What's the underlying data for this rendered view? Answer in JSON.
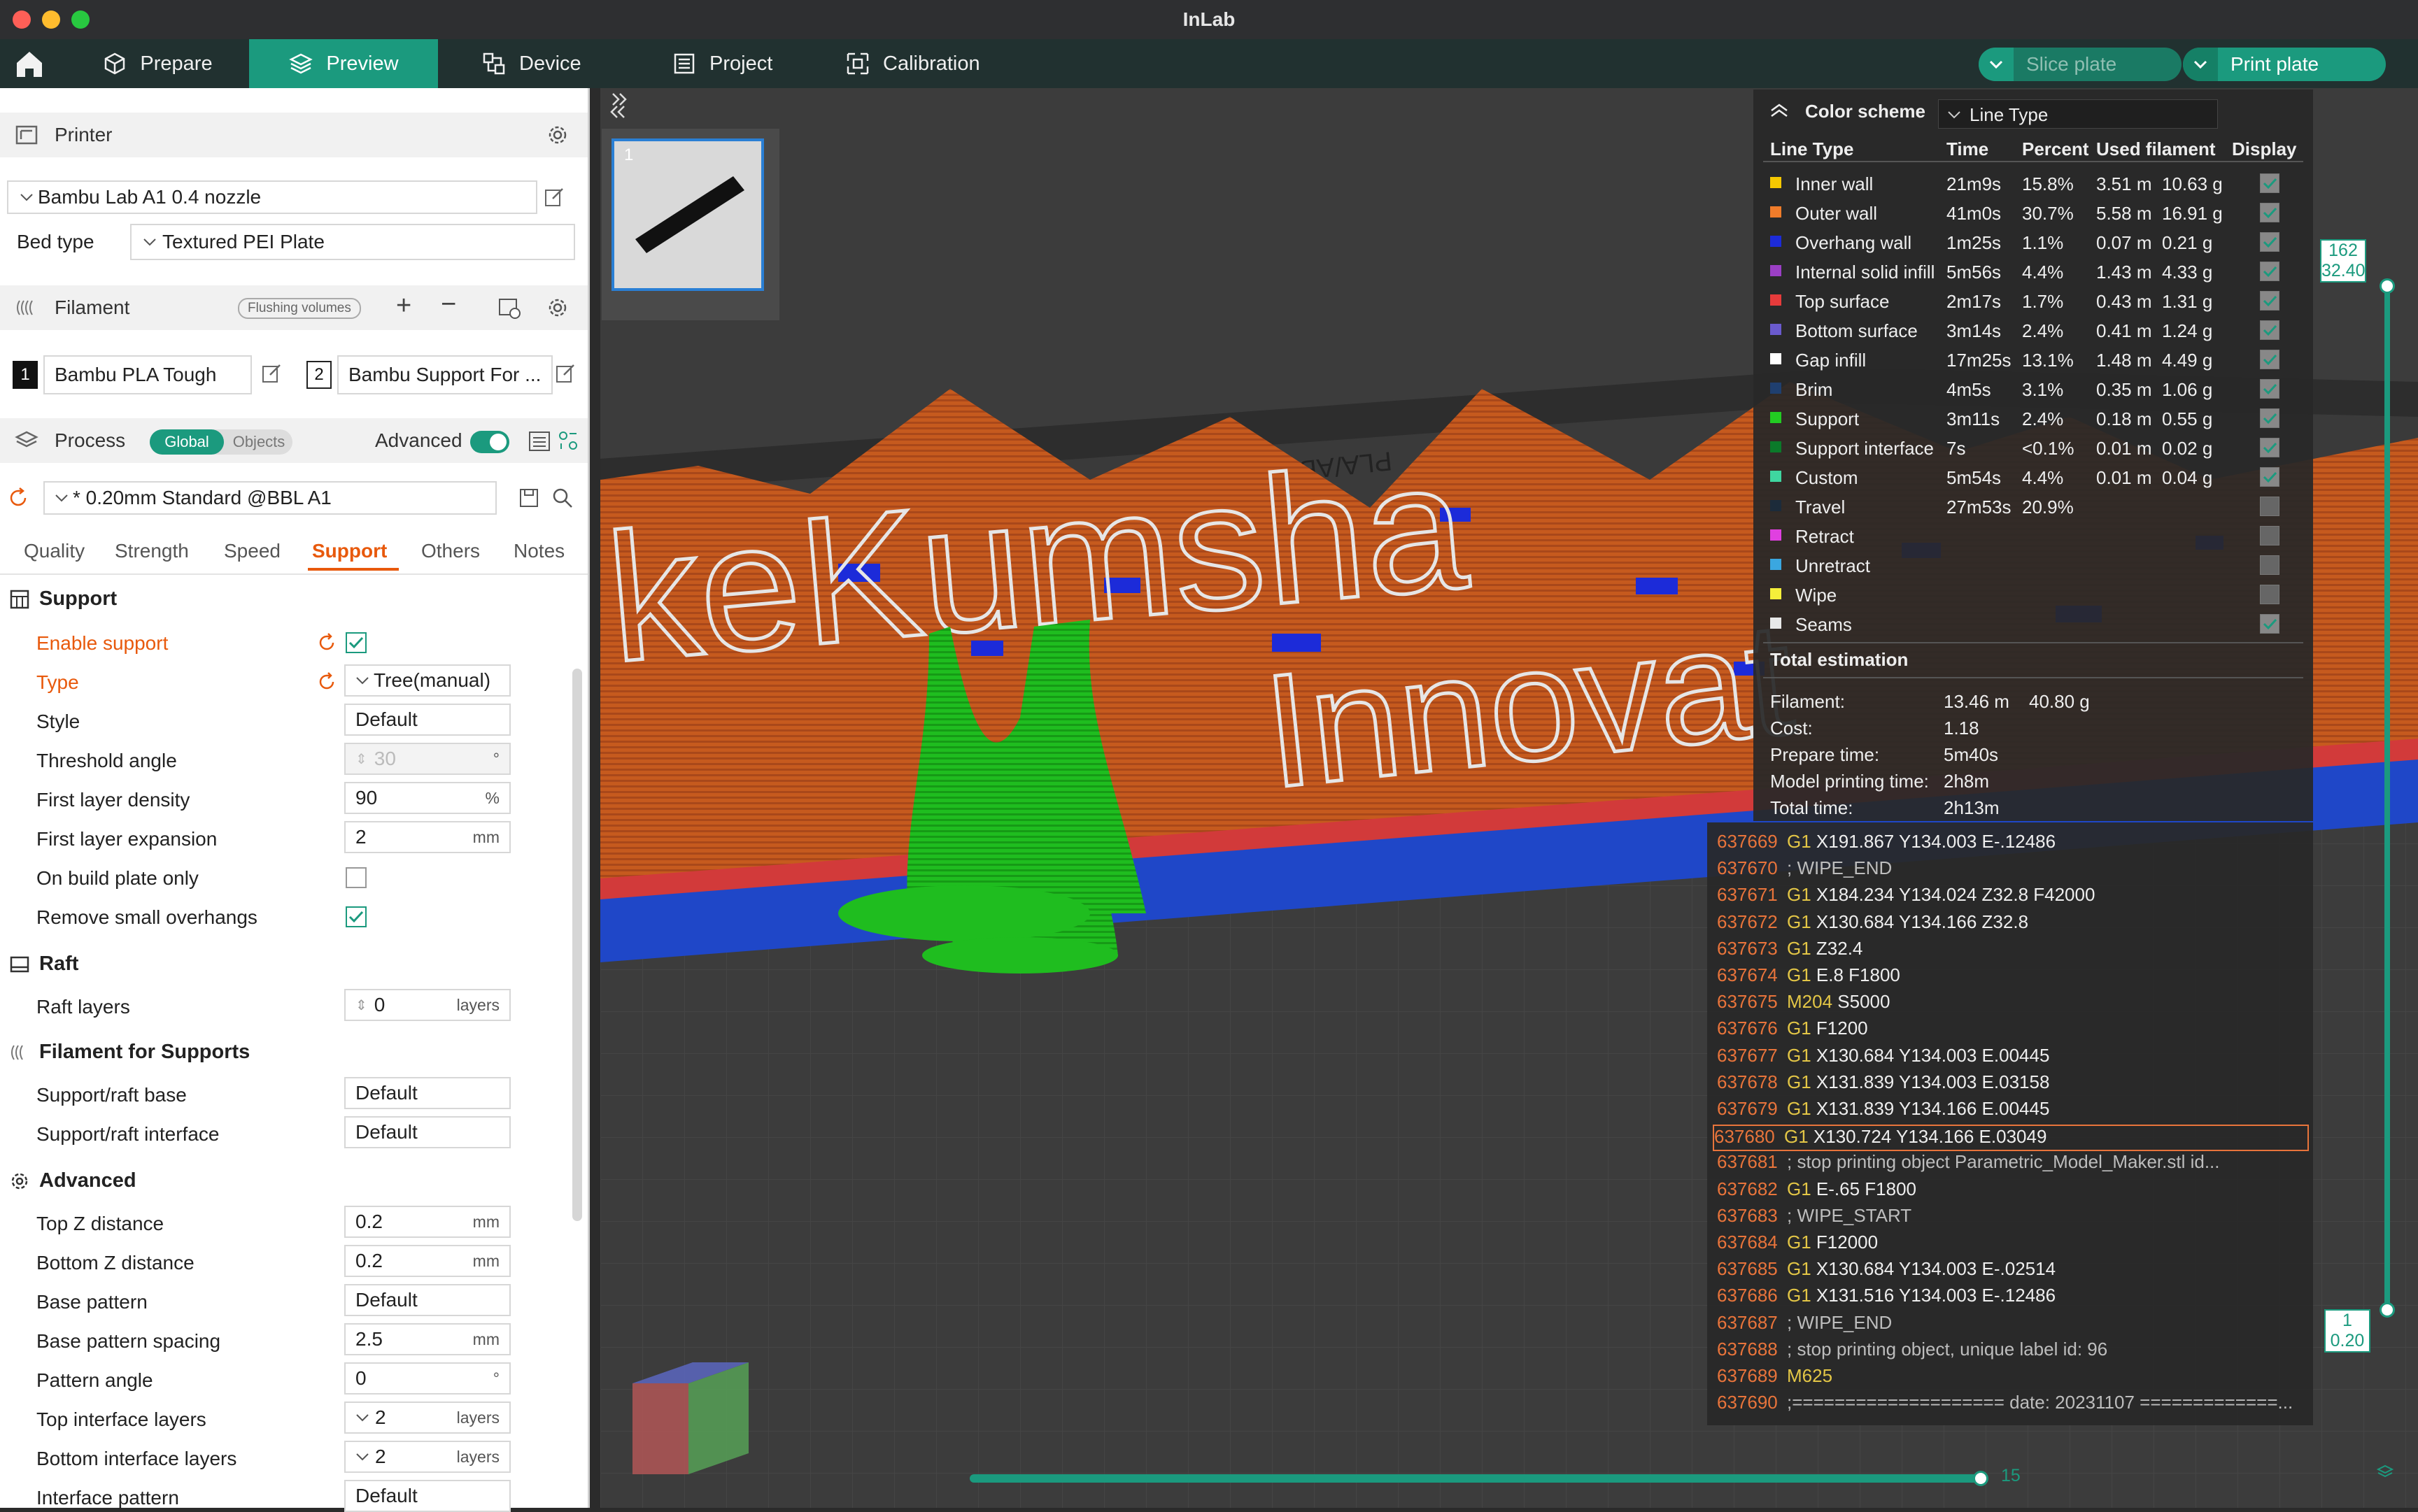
{
  "window": {
    "title": "InLab"
  },
  "nav": {
    "tabs": [
      {
        "label": "Prepare",
        "icon": "cube-icon"
      },
      {
        "label": "Preview",
        "icon": "layers-icon",
        "active": true
      },
      {
        "label": "Device",
        "icon": "device-icon"
      },
      {
        "label": "Project",
        "icon": "project-icon"
      },
      {
        "label": "Calibration",
        "icon": "calibration-icon"
      }
    ],
    "slice_label": "Slice plate",
    "print_label": "Print plate"
  },
  "printer": {
    "section_title": "Printer",
    "name": "Bambu Lab A1 0.4 nozzle",
    "bed_type_label": "Bed type",
    "bed_type": "Textured PEI Plate"
  },
  "filament": {
    "section_title": "Filament",
    "flushing_label": "Flushing volumes",
    "slots": [
      {
        "num": "1",
        "name": "Bambu PLA Tough"
      },
      {
        "num": "2",
        "name": "Bambu Support For ..."
      }
    ]
  },
  "process": {
    "section_title": "Process",
    "toggle_global": "Global",
    "toggle_objects": "Objects",
    "advanced_label": "Advanced",
    "preset": "* 0.20mm Standard @BBL A1",
    "tabs": [
      "Quality",
      "Strength",
      "Speed",
      "Support",
      "Others",
      "Notes"
    ],
    "active_tab": "Support"
  },
  "support": {
    "group_support": "Support",
    "enable_support": "Enable support",
    "type_label": "Type",
    "type_value": "Tree(manual)",
    "style_label": "Style",
    "style_value": "Default",
    "threshold_label": "Threshold angle",
    "threshold_value": "30",
    "threshold_unit": "°",
    "fld_label": "First layer density",
    "fld_value": "90",
    "fld_unit": "%",
    "fle_label": "First layer expansion",
    "fle_value": "2",
    "fle_unit": "mm",
    "obp_label": "On build plate only",
    "rso_label": "Remove small overhangs",
    "group_raft": "Raft",
    "raft_layers_label": "Raft layers",
    "raft_layers_value": "0",
    "raft_layers_unit": "layers",
    "group_filament": "Filament for Supports",
    "base_label": "Support/raft base",
    "base_value": "Default",
    "iface_label": "Support/raft interface",
    "iface_value": "Default",
    "group_advanced": "Advanced",
    "topz_label": "Top Z distance",
    "topz_value": "0.2",
    "botz_label": "Bottom Z distance",
    "botz_value": "0.2",
    "mm": "mm",
    "bp_label": "Base pattern",
    "bp_value": "Default",
    "bps_label": "Base pattern spacing",
    "bps_value": "2.5",
    "pa_label": "Pattern angle",
    "pa_value": "0",
    "deg": "°",
    "til_label": "Top interface layers",
    "til_value": "2",
    "bil_label": "Bottom interface layers",
    "bil_value": "2",
    "layers": "layers",
    "ip_label": "Interface pattern",
    "ip_value": "Default"
  },
  "legend": {
    "color_scheme_label": "Color scheme",
    "color_scheme_value": "Line Type",
    "headers": [
      "Line Type",
      "Time",
      "Percent",
      "Used filament",
      "Display"
    ],
    "rows": [
      {
        "name": "Inner wall",
        "color": "#f5c800",
        "time": "21m9s",
        "percent": "15.8%",
        "len": "3.51 m",
        "weight": "10.63 g",
        "display": true
      },
      {
        "name": "Outer wall",
        "color": "#f07c2a",
        "time": "41m0s",
        "percent": "30.7%",
        "len": "5.58 m",
        "weight": "16.91 g",
        "display": true
      },
      {
        "name": "Overhang wall",
        "color": "#1c2bd9",
        "time": "1m25s",
        "percent": "1.1%",
        "len": "0.07 m",
        "weight": "0.21 g",
        "display": true
      },
      {
        "name": "Internal solid infill",
        "color": "#9b3fc5",
        "time": "5m56s",
        "percent": "4.4%",
        "len": "1.43 m",
        "weight": "4.33 g",
        "display": true
      },
      {
        "name": "Top surface",
        "color": "#e63b3b",
        "time": "2m17s",
        "percent": "1.7%",
        "len": "0.43 m",
        "weight": "1.31 g",
        "display": true
      },
      {
        "name": "Bottom surface",
        "color": "#6a5acd",
        "time": "3m14s",
        "percent": "2.4%",
        "len": "0.41 m",
        "weight": "1.24 g",
        "display": true
      },
      {
        "name": "Gap infill",
        "color": "#ffffff",
        "time": "17m25s",
        "percent": "13.1%",
        "len": "1.48 m",
        "weight": "4.49 g",
        "display": true
      },
      {
        "name": "Brim",
        "color": "#1f3f6f",
        "time": "4m5s",
        "percent": "3.1%",
        "len": "0.35 m",
        "weight": "1.06 g",
        "display": true
      },
      {
        "name": "Support",
        "color": "#22cc22",
        "time": "3m11s",
        "percent": "2.4%",
        "len": "0.18 m",
        "weight": "0.55 g",
        "display": true
      },
      {
        "name": "Support interface",
        "color": "#0b7a2a",
        "time": "7s",
        "percent": "<0.1%",
        "len": "0.01 m",
        "weight": "0.02 g",
        "display": true
      },
      {
        "name": "Custom",
        "color": "#3fd6a0",
        "time": "5m54s",
        "percent": "4.4%",
        "len": "0.01 m",
        "weight": "0.04 g",
        "display": true
      },
      {
        "name": "Travel",
        "color": "#1c2b3a",
        "time": "27m53s",
        "percent": "20.9%",
        "len": "",
        "weight": "",
        "display": false
      },
      {
        "name": "Retract",
        "color": "#e040e0",
        "time": "",
        "percent": "",
        "len": "",
        "weight": "",
        "display": false
      },
      {
        "name": "Unretract",
        "color": "#3aa7e0",
        "time": "",
        "percent": "",
        "len": "",
        "weight": "",
        "display": false
      },
      {
        "name": "Wipe",
        "color": "#f5ef3a",
        "time": "",
        "percent": "",
        "len": "",
        "weight": "",
        "display": false
      },
      {
        "name": "Seams",
        "color": "#e8e8e8",
        "time": "",
        "percent": "",
        "len": "",
        "weight": "",
        "display": true
      }
    ],
    "total_title": "Total estimation",
    "totals": [
      {
        "label": "Filament:",
        "value": "13.46 m",
        "value2": "40.80 g"
      },
      {
        "label": "Cost:",
        "value": "1.18",
        "value2": ""
      },
      {
        "label": "Prepare time:",
        "value": "5m40s",
        "value2": ""
      },
      {
        "label": "Model printing time:",
        "value": "2h8m",
        "value2": ""
      },
      {
        "label": "Total time:",
        "value": "2h13m",
        "value2": ""
      }
    ]
  },
  "gcode": [
    {
      "n": "637669",
      "cmd": "G1",
      "rest": " X191.867 Y134.003 E-.12486"
    },
    {
      "n": "637670",
      "cmd": "",
      "rest": "; WIPE_END"
    },
    {
      "n": "637671",
      "cmd": "G1",
      "rest": " X184.234 Y134.024 Z32.8 F42000"
    },
    {
      "n": "637672",
      "cmd": "G1",
      "rest": " X130.684 Y134.166 Z32.8"
    },
    {
      "n": "637673",
      "cmd": "G1",
      "rest": " Z32.4"
    },
    {
      "n": "637674",
      "cmd": "G1",
      "rest": " E.8 F1800"
    },
    {
      "n": "637675",
      "cmd": "M204",
      "rest": " S5000"
    },
    {
      "n": "637676",
      "cmd": "G1",
      "rest": " F1200"
    },
    {
      "n": "637677",
      "cmd": "G1",
      "rest": " X130.684 Y134.003 E.00445"
    },
    {
      "n": "637678",
      "cmd": "G1",
      "rest": " X131.839 Y134.003 E.03158"
    },
    {
      "n": "637679",
      "cmd": "G1",
      "rest": " X131.839 Y134.166 E.00445"
    },
    {
      "n": "637680",
      "cmd": "G1",
      "rest": " X130.724 Y134.166 E.03049",
      "highlight": true
    },
    {
      "n": "637681",
      "cmd": "",
      "rest": "; stop printing object Parametric_Model_Maker.stl id..."
    },
    {
      "n": "637682",
      "cmd": "G1",
      "rest": " E-.65 F1800"
    },
    {
      "n": "637683",
      "cmd": "",
      "rest": "; WIPE_START"
    },
    {
      "n": "637684",
      "cmd": "G1",
      "rest": " F12000"
    },
    {
      "n": "637685",
      "cmd": "G1",
      "rest": " X130.684 Y134.003 E-.02514"
    },
    {
      "n": "637686",
      "cmd": "G1",
      "rest": " X131.516 Y134.003 E-.12486"
    },
    {
      "n": "637687",
      "cmd": "",
      "rest": "; WIPE_END"
    },
    {
      "n": "637688",
      "cmd": "",
      "rest": "; stop printing object, unique label id: 96"
    },
    {
      "n": "637689",
      "cmd": "M625",
      "rest": ""
    },
    {
      "n": "637690",
      "cmd": "",
      "rest": ";==================== date: 20231107 =============..."
    }
  ],
  "sliders": {
    "top_layer": "162",
    "top_height": "32.40",
    "bottom_layer": "1",
    "bottom_height": "0.20",
    "horizontal_value": "15"
  },
  "plate": {
    "thumb_number": "1",
    "model_text": "keKumsha",
    "model_text2": "Innovat",
    "bed_text": "PLA/ABS/PETG"
  }
}
